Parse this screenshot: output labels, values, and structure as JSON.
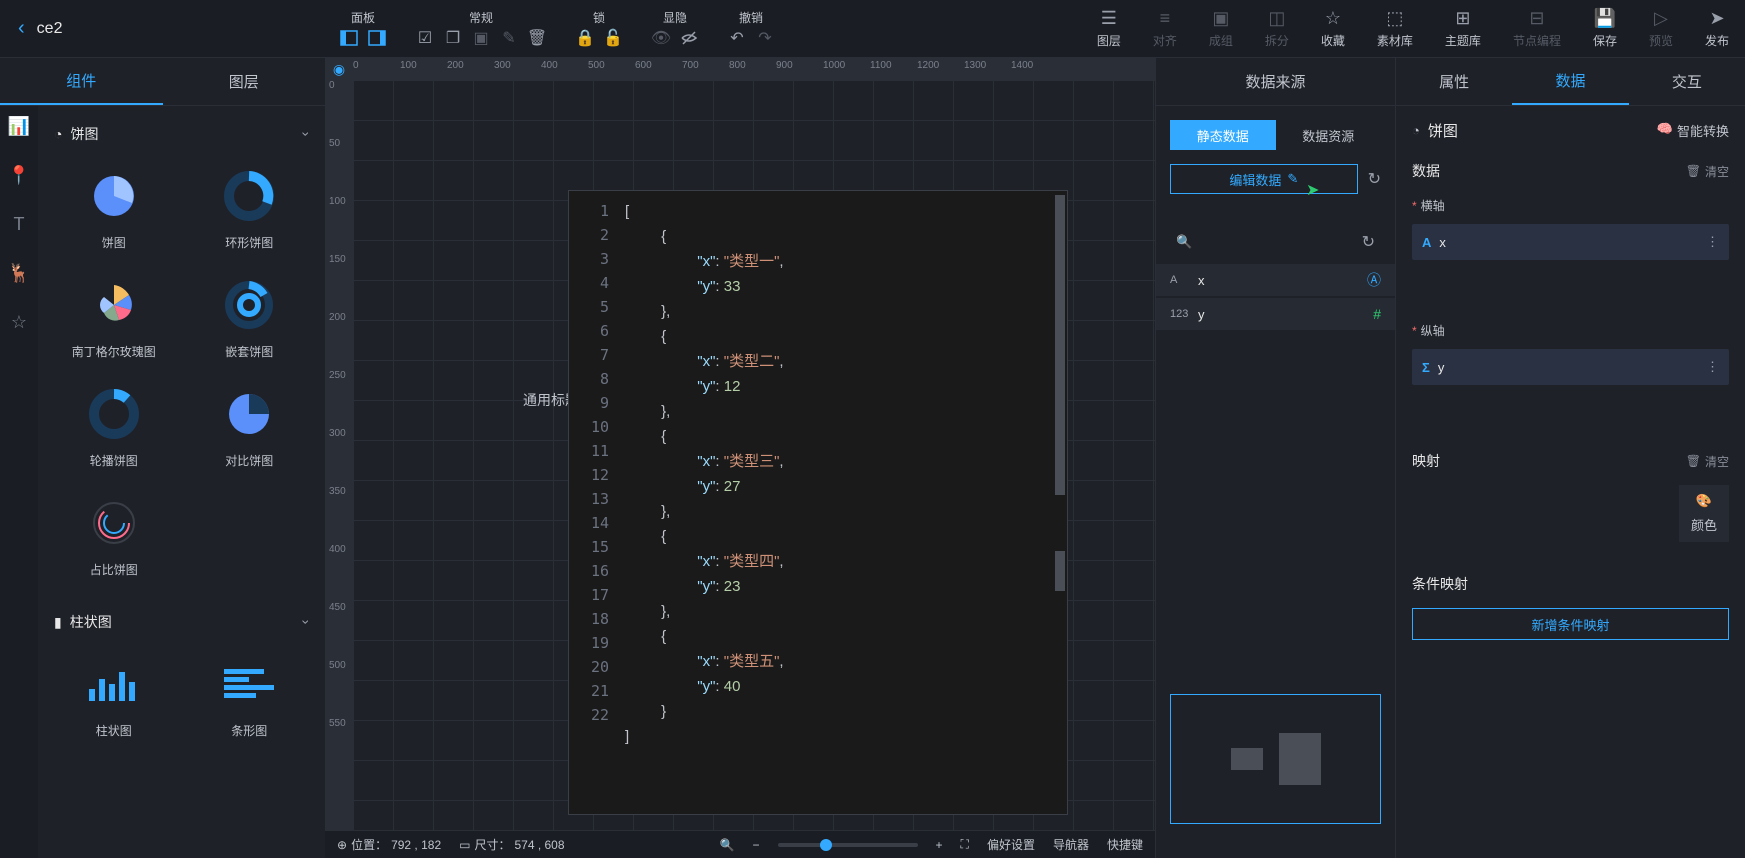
{
  "project_title": "ce2",
  "topbar": {
    "groups": {
      "panel": "面板",
      "general": "常规",
      "lock": "锁",
      "visibility": "显隐",
      "undo": "撤销"
    },
    "right_actions": {
      "layers": "图层",
      "align": "对齐",
      "group": "成组",
      "split": "拆分",
      "favorite": "收藏",
      "materials": "素材库",
      "themes": "主题库",
      "node_prog": "节点编程",
      "save": "保存",
      "preview": "预览",
      "publish": "发布"
    }
  },
  "left_tabs": {
    "components": "组件",
    "layers": "图层"
  },
  "comp_sections": {
    "pie": "饼图",
    "bar": "柱状图"
  },
  "pie_items": {
    "pie": "饼图",
    "donut": "环形饼图",
    "rose": "南丁格尔玫瑰图",
    "nested": "嵌套饼图",
    "carousel": "轮播饼图",
    "compare": "对比饼图",
    "ratio": "占比饼图"
  },
  "bar_items": {
    "bar": "柱状图",
    "strip": "条形图"
  },
  "canvas": {
    "chart_title": "通用标题",
    "ruler_h": [
      "0",
      "100",
      "200",
      "300",
      "400",
      "500",
      "600",
      "700",
      "800",
      "900",
      "1000",
      "1100",
      "1200",
      "1300",
      "1400"
    ],
    "ruler_v": [
      "0",
      "50",
      "100",
      "150",
      "200",
      "250",
      "300",
      "350",
      "400",
      "450",
      "500",
      "550"
    ],
    "code_lines": 22
  },
  "chart_data": {
    "type": "pie",
    "series": [
      {
        "x": "类型一",
        "y": 33
      },
      {
        "x": "类型二",
        "y": 12
      },
      {
        "x": "类型三",
        "y": 27
      },
      {
        "x": "类型四",
        "y": 23
      },
      {
        "x": "类型五",
        "y": 40
      }
    ]
  },
  "data_panel": {
    "title": "数据来源",
    "static": "静态数据",
    "resource": "数据资源",
    "edit": "编辑数据",
    "fields": {
      "x": "x",
      "y": "y"
    }
  },
  "right_panel": {
    "tabs": {
      "attr": "属性",
      "data": "数据",
      "interact": "交互"
    },
    "title": "饼图",
    "smart": "智能转换",
    "data_label": "数据",
    "clear": "清空",
    "haxis": "横轴",
    "vaxis": "纵轴",
    "x_field": "x",
    "y_field": "y",
    "mapping": "映射",
    "color": "颜色",
    "cond_mapping": "条件映射",
    "add_cond": "新增条件映射"
  },
  "footer": {
    "position_label": "位置：",
    "position_val": "792 , 182",
    "size_label": "尺寸：",
    "size_val": "574 , 608",
    "pref": "偏好设置",
    "nav": "导航器",
    "shortcut": "快捷键"
  }
}
